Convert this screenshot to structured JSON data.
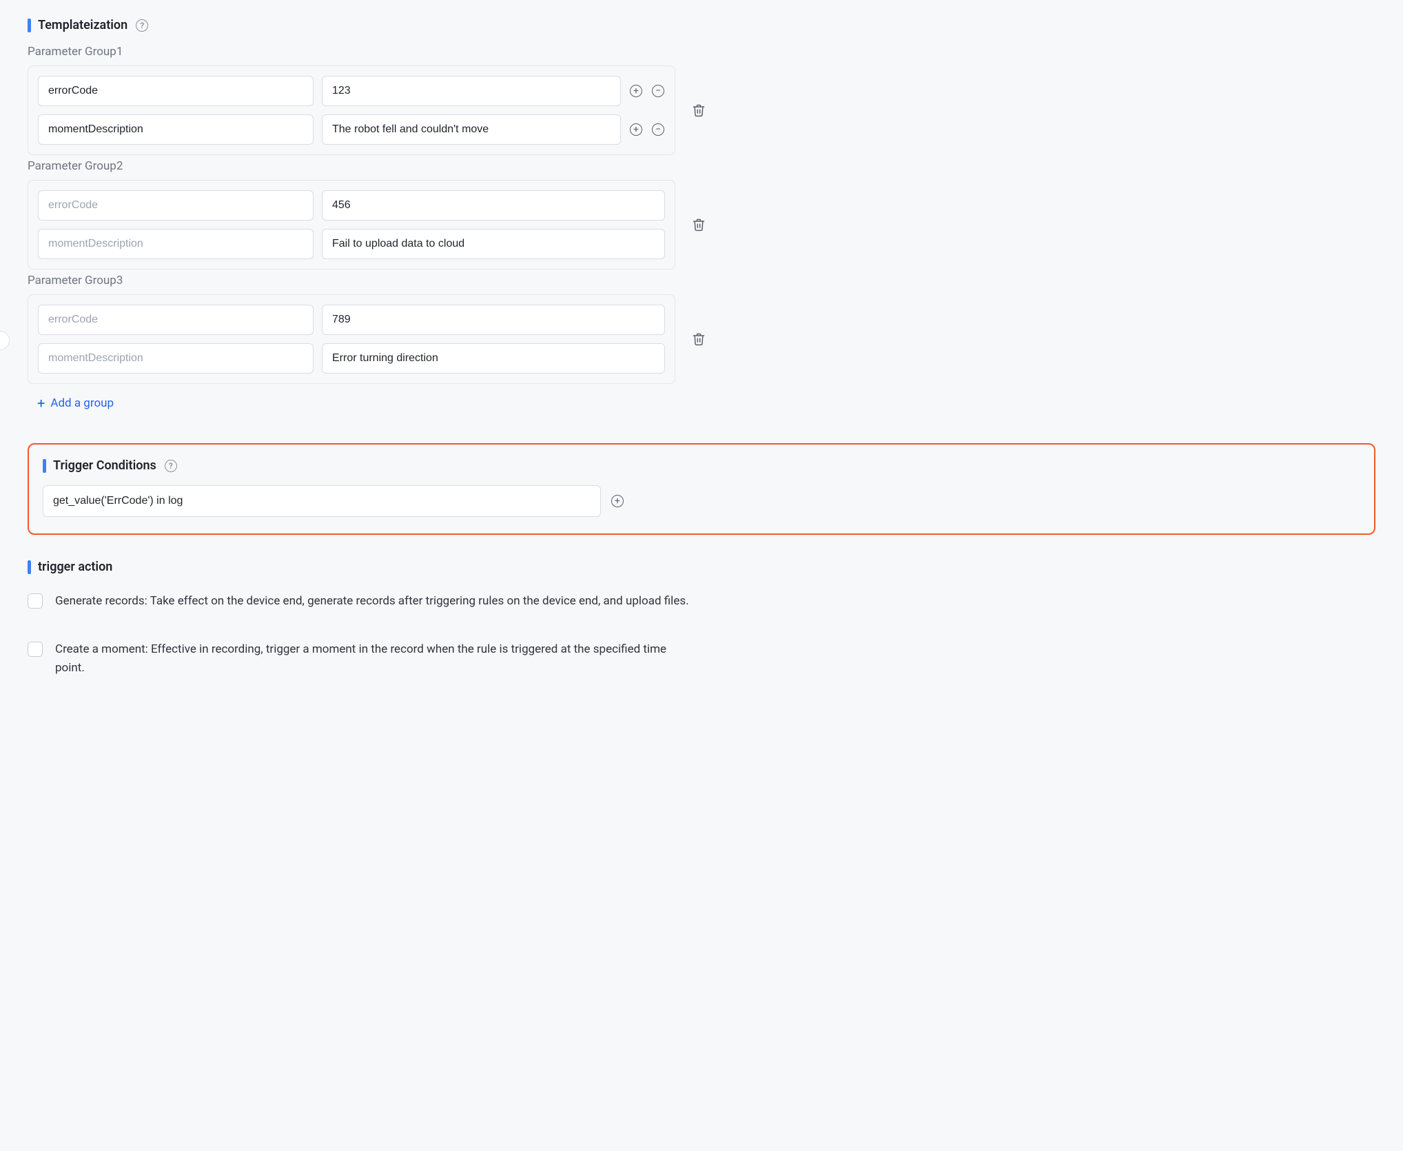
{
  "sections": {
    "templateization": {
      "title": "Templateization",
      "groups": [
        {
          "label": "Parameter Group1",
          "rows": [
            {
              "key": "errorCode",
              "value": "123",
              "keyPlaceholder": "errorCode",
              "valuePlaceholder": "",
              "showAddRemove": true
            },
            {
              "key": "momentDescription",
              "value": "The robot fell and couldn't move",
              "keyPlaceholder": "momentDescription",
              "valuePlaceholder": "",
              "showAddRemove": true
            }
          ]
        },
        {
          "label": "Parameter Group2",
          "rows": [
            {
              "key": "",
              "value": "456",
              "keyPlaceholder": "errorCode",
              "valuePlaceholder": "",
              "showAddRemove": false
            },
            {
              "key": "",
              "value": "Fail to upload data to cloud",
              "keyPlaceholder": "momentDescription",
              "valuePlaceholder": "",
              "showAddRemove": false
            }
          ]
        },
        {
          "label": "Parameter Group3",
          "rows": [
            {
              "key": "",
              "value": "789",
              "keyPlaceholder": "errorCode",
              "valuePlaceholder": "",
              "showAddRemove": false
            },
            {
              "key": "",
              "value": "Error turning direction",
              "keyPlaceholder": "momentDescription",
              "valuePlaceholder": "",
              "showAddRemove": false
            }
          ]
        }
      ],
      "addGroupLabel": "Add a group"
    },
    "triggerConditions": {
      "title": "Trigger Conditions",
      "input": "get_value('ErrCode') in log"
    },
    "triggerAction": {
      "title": "trigger action",
      "options": [
        {
          "label": "Generate records: Take effect on the device end, generate records after triggering rules on the device end, and upload files.",
          "checked": false
        },
        {
          "label": "Create a moment: Effective in recording, trigger a moment in the record when the rule is triggered at the specified time point.",
          "checked": false
        }
      ]
    }
  }
}
